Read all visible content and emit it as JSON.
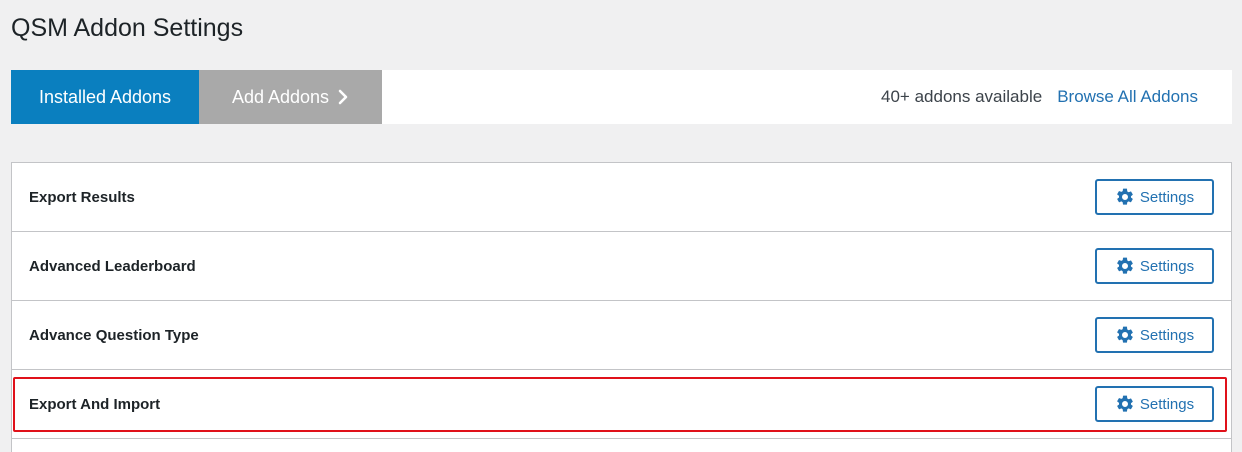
{
  "page": {
    "title": "QSM Addon Settings"
  },
  "tabs": {
    "installed_label": "Installed Addons",
    "add_label": "Add Addons",
    "available_text": "40+ addons available",
    "browse_label": "Browse All Addons"
  },
  "addons": [
    {
      "name": "Export Results",
      "button_label": "Settings"
    },
    {
      "name": "Advanced Leaderboard",
      "button_label": "Settings"
    },
    {
      "name": "Advance Question Type",
      "button_label": "Settings"
    },
    {
      "name": "Export And Import",
      "button_label": "Settings",
      "highlighted": true
    }
  ],
  "colors": {
    "accent": "#0a7fbf",
    "link": "#2271b1",
    "inactive_tab": "#a9a9a9",
    "highlight": "#e0111a"
  },
  "icons": {
    "settings": "gear-icon",
    "add_tab": "chevron-right-icon"
  }
}
